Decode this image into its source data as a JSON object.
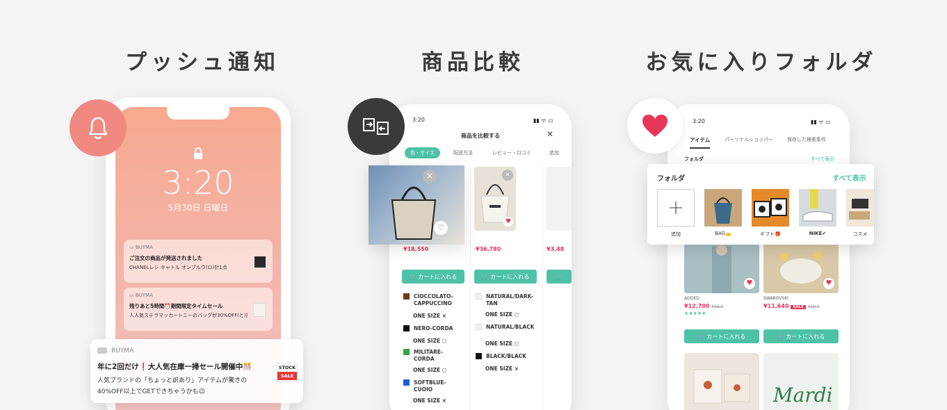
{
  "sections": {
    "push": {
      "title": "プッシュ通知"
    },
    "compare": {
      "title": "商品比較"
    },
    "favorites": {
      "title": "お気に入りフォルダ"
    }
  },
  "push_phone": {
    "time": "3:20",
    "date": "5月30日 日曜日",
    "notifications": [
      {
        "app": "BUYMA",
        "title": "ご注文の商品が発送されました",
        "body": "CHANELレシ キャトル オンブルウ(ロ)計1点"
      },
      {
        "app": "BUYMA",
        "title": "残りあと5時間⏰期間限定タイムセール",
        "body": "人人気ステラマッカートニーのバッグが30%OFF(と)提供中💜"
      }
    ],
    "banner": {
      "app": "BUYMA",
      "title": "年に2回だけ❗大人気在庫一掃セール開催中🎊",
      "body_line1": "人気ブランドの「ちょっと訳あり」アイテムが驚きの",
      "body_line2": "40%OFF以上でGETできちゃうかも😉",
      "tag_top": "STOCK",
      "tag_bottom": "SALE"
    }
  },
  "compare_phone": {
    "status_time": "3:20",
    "header": "商品を比較する",
    "close": "✕",
    "tabs": [
      "色・サイズ",
      "配送方法",
      "レビュー・口コミ",
      "追加"
    ],
    "prices": [
      "¥18,550",
      "¥36,780",
      "¥3,48"
    ],
    "cart_label": "カートに入れる",
    "col1": [
      {
        "name": "CIOCCOLATO-CAPPUCCINO",
        "color": "#6b3a1e",
        "size": "ONE SIZE",
        "mark": "×"
      },
      {
        "name": "NERO-CORDA",
        "color": "#111111",
        "size": "ONE SIZE",
        "mark": "○"
      },
      {
        "name": "MILITARE-CORDA",
        "color": "#3aa048",
        "size": "ONE SIZE",
        "mark": "○"
      },
      {
        "name": "SOFTBLUE-CUOIO",
        "color": "#1a5fd6",
        "size": "ONE SIZE",
        "mark": "×"
      }
    ],
    "col2": [
      {
        "name": "NATURAL/DARK-TAN",
        "color": "#f2f2f2",
        "size": "ONE SIZE",
        "mark": "○"
      },
      {
        "name": "NATURAL/BLACK",
        "color": "#f2f2f2",
        "size": "ONE SIZE",
        "mark": "○"
      },
      {
        "name": "BLACK/BLACK",
        "color": "#111111",
        "size": "ONE SIZE",
        "mark": "×"
      }
    ]
  },
  "fav_phone": {
    "status_time": "3:20",
    "tabs": [
      "アイテム",
      "パーソナルショッパー",
      "保存した検索条件"
    ],
    "folder_label": "フォルダ",
    "see_all": "すべて表示",
    "folders": [
      {
        "label": "追加"
      },
      {
        "label": "BAG👝"
      },
      {
        "label": "ギフト🎁"
      },
      {
        "label": "NIKE✔"
      },
      {
        "label": "コスメ"
      }
    ],
    "products": [
      {
        "brand": "ADDED",
        "price": "¥12,700",
        "old": "¥16,2",
        "stars": "★★★★★"
      },
      {
        "brand": "SWAROVSKI",
        "price": "¥11,640",
        "old": "¥19,4",
        "tag": "SALE"
      }
    ],
    "cart_label": "カートに入れる",
    "mardi_text": "Mardi"
  },
  "colors": {
    "accent_pink": "#f08a80",
    "teal": "#4ec1a6",
    "heart": "#e8355a"
  }
}
